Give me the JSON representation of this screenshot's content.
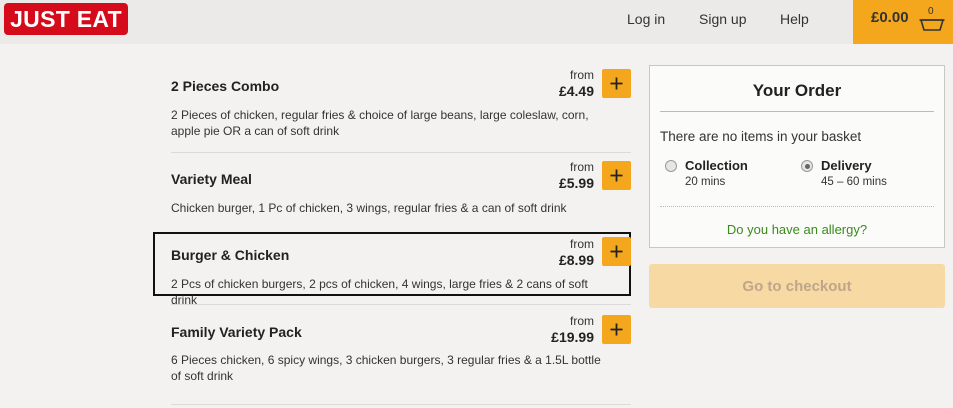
{
  "header": {
    "logo": "JUST EAT",
    "nav": {
      "login": "Log in",
      "signup": "Sign up",
      "help": "Help"
    },
    "basket_total": "£0.00",
    "basket_count": "0"
  },
  "menu": {
    "items": [
      {
        "name": "2 Pieces Combo",
        "from": "from",
        "price": "£4.49",
        "desc": "2 Pieces of chicken, regular fries & choice of large beans, large coleslaw, corn, apple pie OR a can of soft drink"
      },
      {
        "name": "Variety Meal",
        "from": "from",
        "price": "£5.99",
        "desc": "Chicken burger, 1 Pc of chicken, 3 wings, regular fries & a can of soft drink"
      },
      {
        "name": "Burger & Chicken",
        "from": "from",
        "price": "£8.99",
        "desc": "2 Pcs of chicken burgers, 2 pcs of chicken, 4 wings, large fries & 2 cans of soft drink"
      },
      {
        "name": "Family Variety Pack",
        "from": "from",
        "price": "£19.99",
        "desc": "6 Pieces chicken, 6 spicy wings, 3 chicken burgers, 3 regular fries & a 1.5L bottle of soft drink"
      }
    ]
  },
  "order": {
    "title": "Your Order",
    "empty_text": "There are no items in your basket",
    "collection": {
      "label": "Collection",
      "time": "20 mins",
      "selected": false
    },
    "delivery": {
      "label": "Delivery",
      "time": "45 – 60 mins",
      "selected": true
    },
    "allergy_link": "Do you have an allergy?",
    "checkout_label": "Go to checkout"
  },
  "colors": {
    "brand_red": "#d50b1b",
    "accent_orange": "#f4a71d",
    "link_green": "#3a8a1c",
    "checkout_disabled": "#f7d9a4"
  }
}
